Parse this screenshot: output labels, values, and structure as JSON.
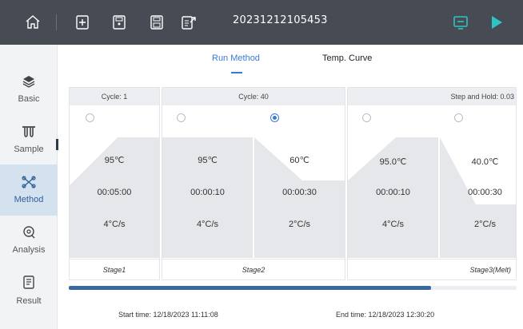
{
  "header": {
    "title": "20231212105453",
    "icons": [
      "home-icon",
      "new-file-icon",
      "open-file-icon",
      "save-icon",
      "export-icon",
      "device-icon",
      "run-icon"
    ]
  },
  "sidebar": {
    "items": [
      {
        "label": "Basic",
        "icon": "layers-icon"
      },
      {
        "label": "Sample",
        "icon": "tubes-icon"
      },
      {
        "label": "Method",
        "icon": "method-icon",
        "active": true
      },
      {
        "label": "Analysis",
        "icon": "analysis-icon"
      },
      {
        "label": "Result",
        "icon": "result-icon"
      }
    ]
  },
  "tabs": [
    {
      "label": "Run Method",
      "active": true
    },
    {
      "label": "Temp. Curve",
      "active": false
    }
  ],
  "stages": [
    {
      "header": "Cycle: 1",
      "name": "Stage1",
      "steps": [
        {
          "temp": "95℃",
          "time": "00:05:00",
          "rate": "4°C/s",
          "selected": false
        }
      ]
    },
    {
      "header": "Cycle: 40",
      "name": "Stage2",
      "steps": [
        {
          "temp": "95℃",
          "time": "00:00:10",
          "rate": "4°C/s",
          "selected": false
        },
        {
          "temp": "60℃",
          "time": "00:00:30",
          "rate": "2°C/s",
          "selected": true
        }
      ]
    },
    {
      "header": "Step and Hold: 0.03",
      "name": "Stage3(Melt)",
      "steps": [
        {
          "temp": "95.0℃",
          "time": "00:00:10",
          "rate": "4°C/s",
          "selected": false
        },
        {
          "temp": "40.0℃",
          "time": "00:00:30",
          "rate": "2°C/s",
          "selected": false
        }
      ]
    }
  ],
  "footer": {
    "start_time": "Start time: 12/18/2023 11:11:08",
    "end_time": "End time: 12/18/2023 12:30:20"
  },
  "colors": {
    "topbar": "#474c54",
    "accent": "#3a7bd5",
    "run_green": "#2ec4c4",
    "step_fill": "#e5e7ea"
  }
}
